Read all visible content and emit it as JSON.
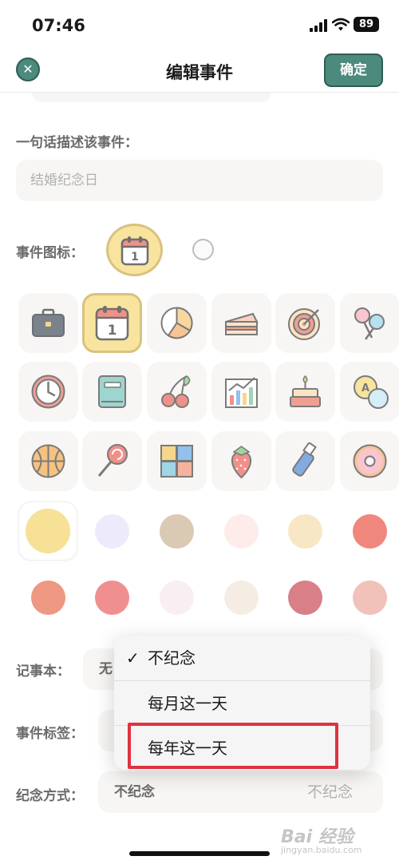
{
  "status_bar": {
    "time": "07:46",
    "battery": "89"
  },
  "nav": {
    "close_icon": "x-icon",
    "title": "编辑事件",
    "confirm_label": "确定"
  },
  "description": {
    "label": "一句话描述该事件：",
    "value": "结婚纪念日"
  },
  "event_icon": {
    "label": "事件图标：",
    "selected_icon": "calendar-icon",
    "calendar_number": "1"
  },
  "icon_grid": [
    "briefcase-icon",
    "calendar-icon",
    "pie-chart-icon",
    "cake-slice-icon",
    "target-icon",
    "cotton-candy-icon",
    "clock-icon",
    "book-icon",
    "cherries-icon",
    "bar-chart-icon",
    "birthday-cake-icon",
    "translate-icon",
    "basketball-icon",
    "lollipop-icon",
    "puzzle-icon",
    "strawberry-icon",
    "usb-drive-icon",
    "donut-icon"
  ],
  "selected_icon_index": 1,
  "colors": {
    "row1": [
      "#f2d25f",
      "#e3e1f9",
      "#c6ad8a",
      "#fde2e0",
      "#f3dba6",
      "#e94836"
    ],
    "row2": [
      "#e5603f",
      "#e95454",
      "#f6e5ea",
      "#f0e4d6",
      "#c43b48",
      "#e8a294"
    ],
    "selected_index": 0
  },
  "notebook": {
    "label": "记事本：",
    "value": "无"
  },
  "event_tag": {
    "label": "事件标签："
  },
  "commemorate": {
    "label": "纪念方式：",
    "value": "不纪念",
    "placeholder": "不纪念"
  },
  "dropdown": {
    "options": [
      "不纪念",
      "每月这一天",
      "每年这一天"
    ],
    "checked_index": 0,
    "check_mark": "✓"
  },
  "watermark": {
    "text": "Bai 经验",
    "sub": "jingyan.baidu.com"
  }
}
